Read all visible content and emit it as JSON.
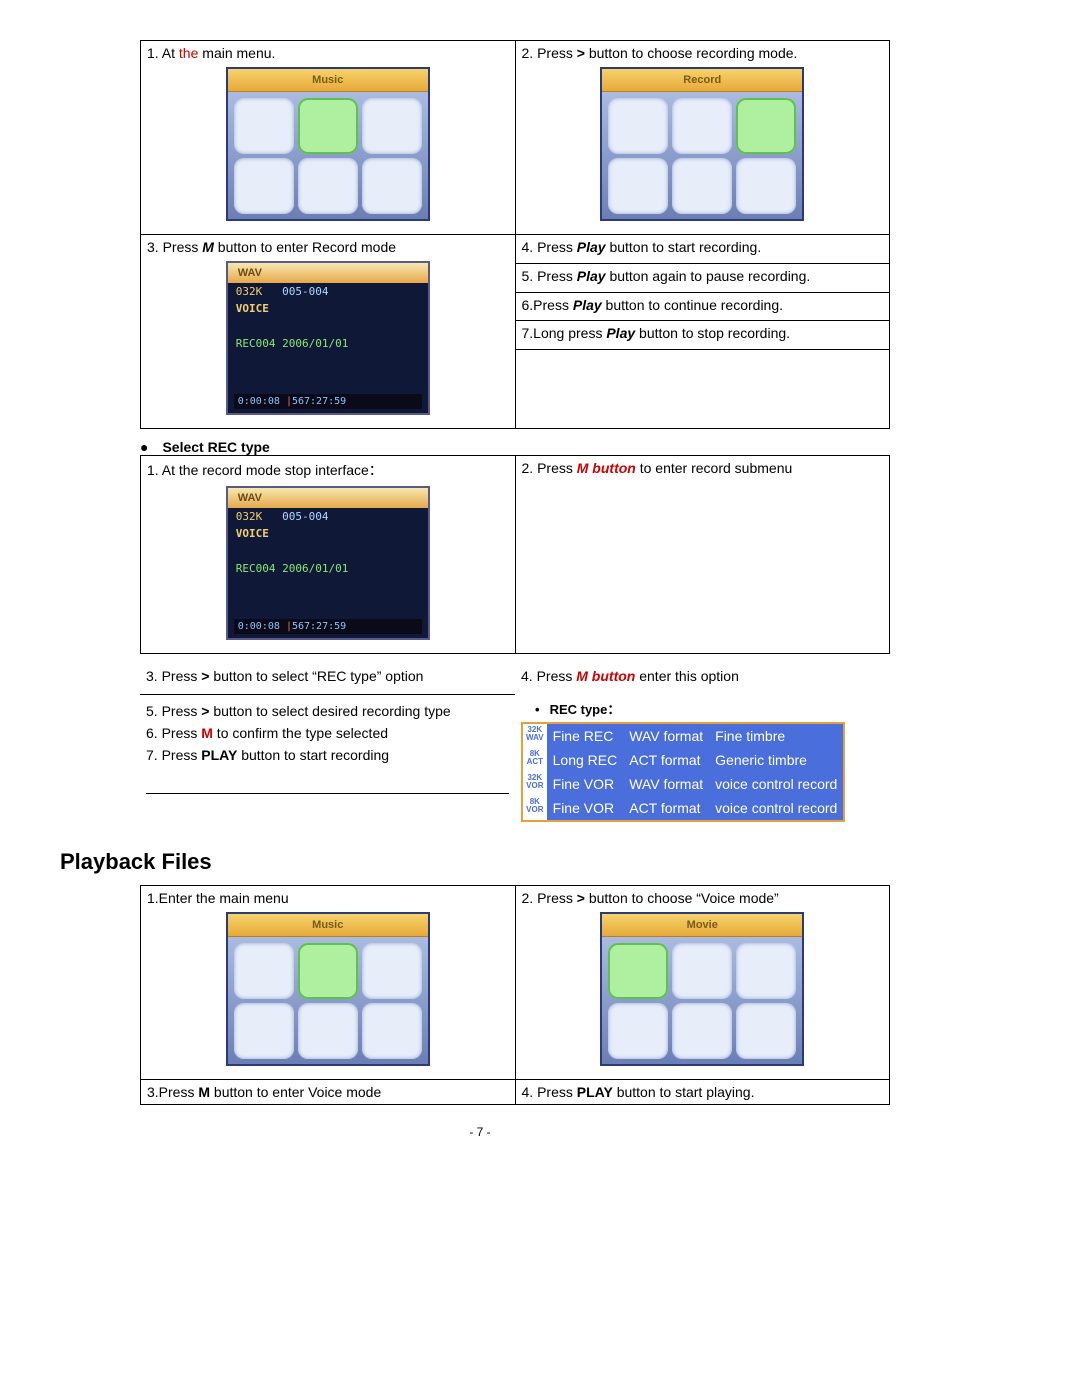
{
  "table1": {
    "r1c1_pre": "1. At ",
    "r1c1_red": "the",
    "r1c1_post": " main menu.",
    "r1c2_pre": "2. Press ",
    "r1c2_sym": ">",
    "r1c2_post": " button to choose recording mode.",
    "r3c1_pre": "3. Press ",
    "r3c1_m": "M",
    "r3c1_post": " button to enter Record mode",
    "r3c2_pre": "4. Press ",
    "r3c2_b": "Play",
    "r3c2_post": " button to start recording.",
    "r4c2_pre": "5. Press ",
    "r4c2_b": "Play",
    "r4c2_post": " button again to pause recording.",
    "r5c2_pre": "6.Press ",
    "r5c2_b": "Play",
    "r5c2_post": " button to continue recording.",
    "r6c2_pre": "7.Long press ",
    "r6c2_b": "Play",
    "r6c2_post": " button to stop recording."
  },
  "menu1_title": "Music",
  "menu2_title": "Record",
  "rec_screen": {
    "wav": "WAV",
    "k": "032K",
    "idx": "005-004",
    "voice": "VOICE",
    "file": "REC004 2006/01/01",
    "t1": "0:00:08",
    "t2": "567:27:59"
  },
  "bullet1": "Select REC type",
  "table2": {
    "r1c1": "1. At the record mode stop interface：",
    "r1c2_pre": "2. Press ",
    "r1c2_m": "M button",
    "r1c2_post": " to enter record submenu",
    "r3c1_pre": "3. Press ",
    "r3c1_sym": ">",
    "r3c1_post": " button to select “REC type” option",
    "r3c2_pre": "4. Press ",
    "r3c2_m": "M button",
    "r3c2_post": " enter this option",
    "r5c1_pre": "5. Press ",
    "r5c1_sym": ">",
    "r5c1_post": " button to select desired recording type",
    "r6c1_pre": "6. Press ",
    "r6c1_m": "M",
    "r6c1_post": " to confirm the type selected",
    "r7c1_pre": "7. Press ",
    "r7c1_b": "PLAY",
    "r7c1_post": " button to start recording",
    "rectype_label": "REC type："
  },
  "rec_types": [
    {
      "ico1": "32K",
      "ico2": "WAV",
      "c1": "Fine REC",
      "c2": "WAV format",
      "c3": "Fine timbre"
    },
    {
      "ico1": "8K",
      "ico2": "ACT",
      "c1": "Long REC",
      "c2": "ACT format",
      "c3": "Generic timbre"
    },
    {
      "ico1": "32K",
      "ico2": "VOR",
      "c1": "Fine VOR",
      "c2": "WAV format",
      "c3": "voice control record"
    },
    {
      "ico1": "8K",
      "ico2": "VOR",
      "c1": "Fine VOR",
      "c2": "ACT format",
      "c3": "voice control record"
    }
  ],
  "section2": "Playback Files",
  "table3": {
    "r1c1": "1.Enter the main menu",
    "r1c2_pre": "2. Press ",
    "r1c2_sym": ">",
    "r1c2_post": " button to choose “Voice mode”",
    "r3c1_pre": "3.Press ",
    "r3c1_m": "M",
    "r3c1_post": " button to enter Voice mode",
    "r3c2_pre": "4. Press ",
    "r3c2_b": "PLAY",
    "r3c2_post": " button to start playing."
  },
  "menu3_title": "Music",
  "menu4_title": "Movie",
  "pagenum": "- 7 -"
}
